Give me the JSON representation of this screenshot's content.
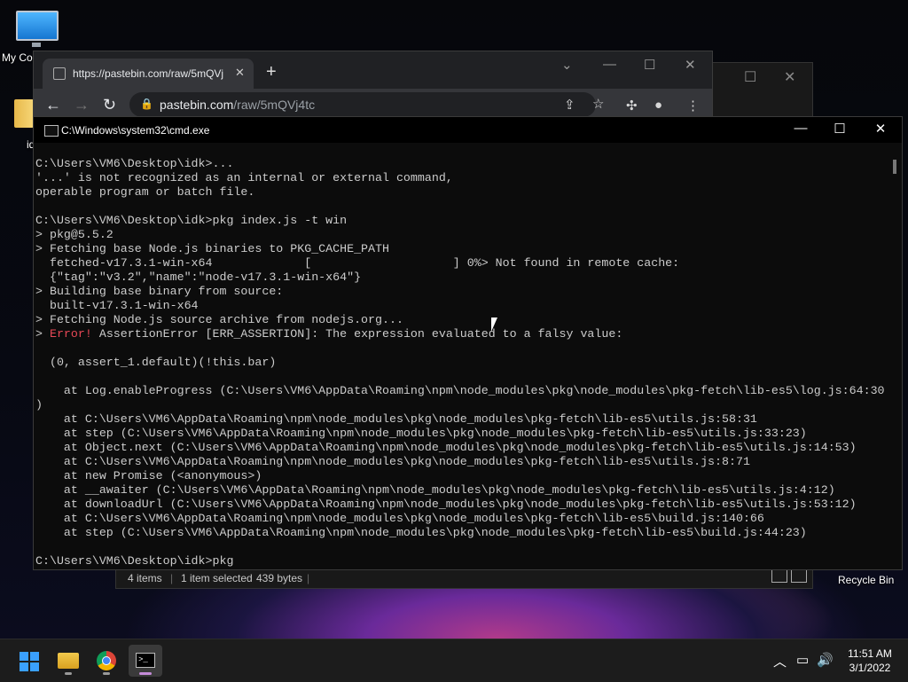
{
  "desktop": {
    "icons": [
      {
        "label": "My Co"
      },
      {
        "label": "id"
      }
    ],
    "recycle_bin": "Recycle Bin"
  },
  "explorer": {
    "status_items": "4 items",
    "status_selected": "1 item selected",
    "status_size": "439 bytes"
  },
  "chrome": {
    "tab_title": "https://pastebin.com/raw/5mQVj",
    "url_host": "pastebin.com",
    "url_path": "/raw/5mQVj4tc"
  },
  "cmd": {
    "title": "C:\\Windows\\system32\\cmd.exe",
    "lines": [
      {
        "text": "C:\\Users\\VM6\\Desktop\\idk>..."
      },
      {
        "text": "'...' is not recognized as an internal or external command,"
      },
      {
        "text": "operable program or batch file."
      },
      {
        "text": ""
      },
      {
        "text": "C:\\Users\\VM6\\Desktop\\idk>pkg index.js -t win"
      },
      {
        "text": "> pkg@5.5.2"
      },
      {
        "text": "> Fetching base Node.js binaries to PKG_CACHE_PATH"
      },
      {
        "text": "  fetched-v17.3.1-win-x64             [                    ] 0%> Not found in remote cache:"
      },
      {
        "text": "  {\"tag\":\"v3.2\",\"name\":\"node-v17.3.1-win-x64\"}"
      },
      {
        "text": "> Building base binary from source:"
      },
      {
        "text": "  built-v17.3.1-win-x64"
      },
      {
        "text": "> Fetching Node.js source archive from nodejs.org..."
      },
      {
        "prefix": "> ",
        "error": "Error!",
        "text": " AssertionError [ERR_ASSERTION]: The expression evaluated to a falsy value:"
      },
      {
        "text": ""
      },
      {
        "text": "  (0, assert_1.default)(!this.bar)"
      },
      {
        "text": ""
      },
      {
        "text": "    at Log.enableProgress (C:\\Users\\VM6\\AppData\\Roaming\\npm\\node_modules\\pkg\\node_modules\\pkg-fetch\\lib-es5\\log.js:64:30"
      },
      {
        "text": ")"
      },
      {
        "text": "    at C:\\Users\\VM6\\AppData\\Roaming\\npm\\node_modules\\pkg\\node_modules\\pkg-fetch\\lib-es5\\utils.js:58:31"
      },
      {
        "text": "    at step (C:\\Users\\VM6\\AppData\\Roaming\\npm\\node_modules\\pkg\\node_modules\\pkg-fetch\\lib-es5\\utils.js:33:23)"
      },
      {
        "text": "    at Object.next (C:\\Users\\VM6\\AppData\\Roaming\\npm\\node_modules\\pkg\\node_modules\\pkg-fetch\\lib-es5\\utils.js:14:53)"
      },
      {
        "text": "    at C:\\Users\\VM6\\AppData\\Roaming\\npm\\node_modules\\pkg\\node_modules\\pkg-fetch\\lib-es5\\utils.js:8:71"
      },
      {
        "text": "    at new Promise (<anonymous>)"
      },
      {
        "text": "    at __awaiter (C:\\Users\\VM6\\AppData\\Roaming\\npm\\node_modules\\pkg\\node_modules\\pkg-fetch\\lib-es5\\utils.js:4:12)"
      },
      {
        "text": "    at downloadUrl (C:\\Users\\VM6\\AppData\\Roaming\\npm\\node_modules\\pkg\\node_modules\\pkg-fetch\\lib-es5\\utils.js:53:12)"
      },
      {
        "text": "    at C:\\Users\\VM6\\AppData\\Roaming\\npm\\node_modules\\pkg\\node_modules\\pkg-fetch\\lib-es5\\build.js:140:66"
      },
      {
        "text": "    at step (C:\\Users\\VM6\\AppData\\Roaming\\npm\\node_modules\\pkg\\node_modules\\pkg-fetch\\lib-es5\\build.js:44:23)"
      },
      {
        "text": ""
      },
      {
        "text": "C:\\Users\\VM6\\Desktop\\idk>pkg"
      }
    ],
    "error_color": "#e74856",
    "text_color": "#cccccc"
  },
  "taskbar": {
    "apps": [
      "start-icon",
      "file-explorer-icon",
      "chrome-icon",
      "terminal-icon"
    ],
    "time": "11:51 AM",
    "date": "3/1/2022"
  }
}
